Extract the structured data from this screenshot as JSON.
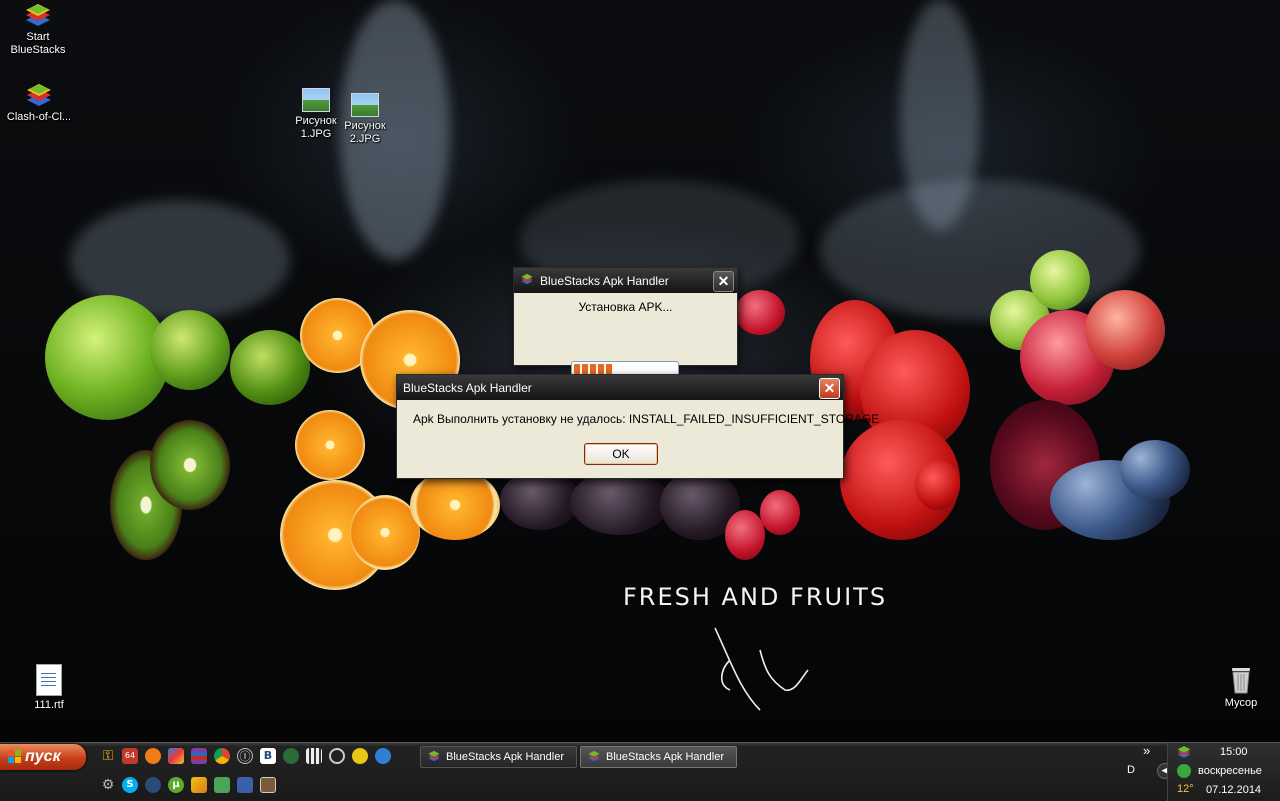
{
  "desktop": {
    "icons": [
      {
        "label_line1": "Start",
        "label_line2": "BlueStacks",
        "icon": "bluestacks-icon"
      },
      {
        "label_line1": "Clash-of-Cl...",
        "label_line2": "",
        "icon": "bluestacks-icon"
      },
      {
        "label_line1": "Рисунок",
        "label_line2": "1.JPG",
        "icon": "image-file-icon"
      },
      {
        "label_line1": "Рисунок",
        "label_line2": "2.JPG",
        "icon": "image-file-icon"
      },
      {
        "label_line1": "111.rtf",
        "label_line2": "",
        "icon": "document-icon"
      },
      {
        "label_line1": "Мусор",
        "label_line2": "",
        "icon": "recycle-bin-icon"
      }
    ],
    "wallpaper_caption": "FRESH AND FRUITS"
  },
  "progress_dialog": {
    "title": "BlueStacks Apk Handler",
    "message": "Установка APK...",
    "progress_fraction": 0.38
  },
  "error_dialog": {
    "title": "BlueStacks Apk Handler",
    "message": "Apk Выполнить установку не удалось: INSTALL_FAILED_INSUFFICIENT_STORAGE",
    "ok_label": "OK"
  },
  "taskbar": {
    "start_label": "пуск",
    "expand_label": "»",
    "language": "D",
    "tasks": [
      {
        "label": "BlueStacks Apk Handler",
        "active": false
      },
      {
        "label": "BlueStacks Apk Handler",
        "active": true
      }
    ],
    "quick_launch_icons": [
      "key-icon",
      "64-icon",
      "avast-icon",
      "games-icon",
      "winrar-icon",
      "chrome-icon",
      "info-icon",
      "vk-icon",
      "chart-icon",
      "clapper-icon",
      "hammer-icon",
      "yellow-icon",
      "refresh-icon",
      "gear-icon",
      "skype-icon",
      "music-icon",
      "utorrent-icon",
      "pencil-icon",
      "monitor-icon",
      "tools-icon",
      "panel-icon"
    ],
    "quick_launch_64": "64",
    "quick_launch_vk": "B"
  },
  "tray": {
    "time": "15:00",
    "day": "воскресенье",
    "date": "07.12.2014",
    "temperature": "12°"
  },
  "colors": {
    "taskbar": "#1a1a1a",
    "start_button": "#c6401b",
    "progress_fill": "#e86a1f",
    "dialog_bg": "#ece9d8"
  }
}
